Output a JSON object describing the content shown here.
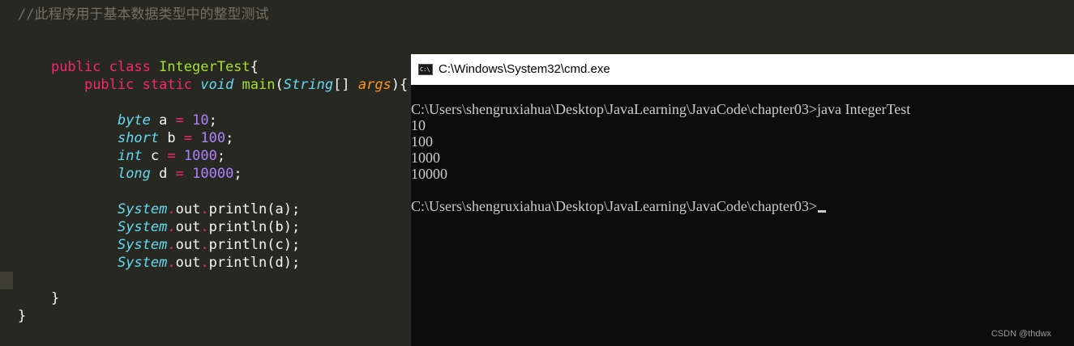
{
  "editor": {
    "comment": "//此程序用于基本数据类型中的整型测试",
    "line_class": {
      "kw1": "public",
      "kw2": "class",
      "name": "IntegerTest",
      "brace": "{"
    },
    "line_main": {
      "kw1": "public",
      "kw2": "static",
      "ret": "void",
      "fn": "main",
      "open": "(",
      "type": "String",
      "arr": "[] ",
      "param": "args",
      "close": "){"
    },
    "decls": [
      {
        "type": "byte",
        "name": " a ",
        "op": "=",
        "value": "10",
        "end": ";"
      },
      {
        "type": "short",
        "name": " b ",
        "op": "=",
        "value": "100",
        "end": ";"
      },
      {
        "type": "int",
        "name": " c ",
        "op": "=",
        "value": "1000",
        "end": ";"
      },
      {
        "type": "long",
        "name": " d ",
        "op": "=",
        "value": "10000",
        "end": ";"
      }
    ],
    "prints": [
      {
        "cls": "System",
        "dot1": ".",
        "field": "out",
        "dot2": ".",
        "call": "println(a);"
      },
      {
        "cls": "System",
        "dot1": ".",
        "field": "out",
        "dot2": ".",
        "call": "println(b);"
      },
      {
        "cls": "System",
        "dot1": ".",
        "field": "out",
        "dot2": ".",
        "call": "println(c);"
      },
      {
        "cls": "System",
        "dot1": ".",
        "field": "out",
        "dot2": ".",
        "call": "println(d);"
      }
    ],
    "close_inner": "}",
    "close_outer": "}"
  },
  "cmd": {
    "icon_text": "C:\\",
    "title": "C:\\Windows\\System32\\cmd.exe",
    "lines": [
      "C:\\Users\\shengruxiahua\\Desktop\\JavaLearning\\JavaCode\\chapter03>java IntegerTest",
      "10",
      "100",
      "1000",
      "10000",
      "",
      "C:\\Users\\shengruxiahua\\Desktop\\JavaLearning\\JavaCode\\chapter03>"
    ]
  },
  "watermark": "CSDN @thdwx"
}
